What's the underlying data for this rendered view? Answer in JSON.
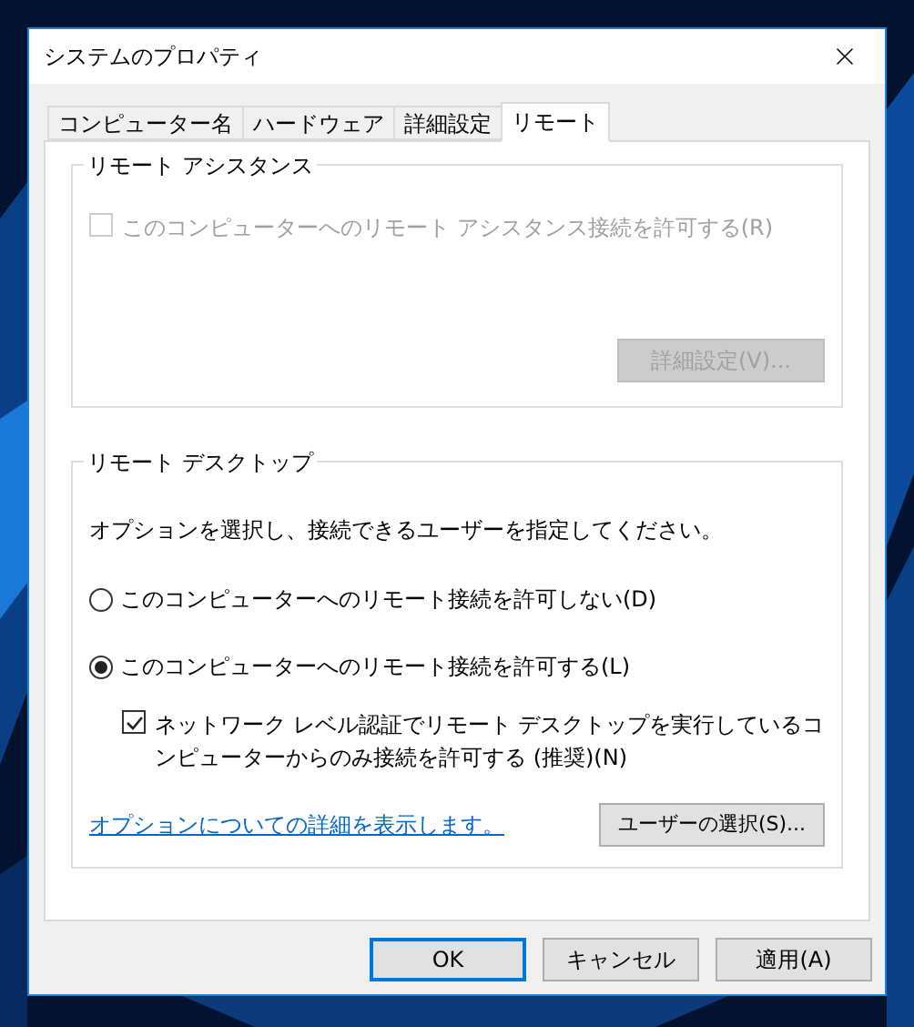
{
  "window": {
    "title": "システムのプロパティ"
  },
  "tabs": [
    {
      "label": "コンピューター名",
      "selected": false
    },
    {
      "label": "ハードウェア",
      "selected": false
    },
    {
      "label": "詳細設定",
      "selected": false
    },
    {
      "label": "リモート",
      "selected": true
    }
  ],
  "remote_assistance": {
    "title": "リモート アシスタンス",
    "checkbox": {
      "label": "このコンピューターへのリモート アシスタンス接続を許可する(R)",
      "checked": false,
      "disabled": true
    },
    "advanced_button": {
      "label": "詳細設定(V)...",
      "disabled": true
    }
  },
  "remote_desktop": {
    "title": "リモート デスクトップ",
    "description": "オプションを選択し、接続できるユーザーを指定してください。",
    "options": [
      {
        "label": "このコンピューターへのリモート接続を許可しない(D)",
        "selected": false
      },
      {
        "label": "このコンピューターへのリモート接続を許可する(L)",
        "selected": true
      }
    ],
    "nla_checkbox": {
      "label": "ネットワーク レベル認証でリモート デスクトップを実行しているコンピューターからのみ接続を許可する (推奨)(N)",
      "checked": true,
      "disabled": false
    },
    "help_link": "オプションについての詳細を表示します。",
    "select_users_button": "ユーザーの選択(S)..."
  },
  "buttons": [
    {
      "label": "OK",
      "default": true
    },
    {
      "label": "キャンセル",
      "default": false
    },
    {
      "label": "適用(A)",
      "default": false
    }
  ]
}
